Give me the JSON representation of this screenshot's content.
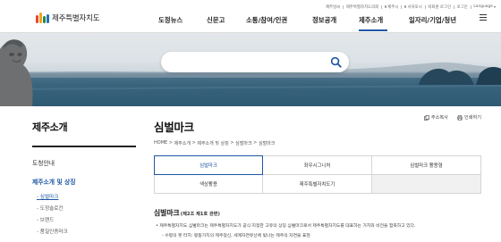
{
  "utility": {
    "items": [
      "제주날씨",
      "제주특별자치도의회",
      "제주시",
      "서귀포시",
      "비회원 로그인",
      "로그인"
    ],
    "language": "Language"
  },
  "header": {
    "logo_text": "제주특별자치도",
    "nav": [
      "도정뉴스",
      "신문고",
      "소통/참여/인권",
      "정보공개",
      "제주소개",
      "일자리/기업/청년"
    ],
    "active_nav": "제주소개"
  },
  "lnb": {
    "title": "제주소개",
    "items": [
      "도청안내",
      "제주소개 및 상징"
    ],
    "active_item": "제주소개 및 상징",
    "subitems": [
      "심벌마크",
      "도정슬로건",
      "브랜드",
      "품질인증마크"
    ],
    "active_subitem": "심벌마크"
  },
  "content": {
    "title": "심벌마크",
    "tools": [
      "주소복사",
      "인쇄하기"
    ],
    "breadcrumb": [
      "HOME",
      "제주소개",
      "제주소개 및 상징",
      "심벌마크",
      "심벌마크"
    ],
    "tabs": [
      "심벌마크",
      "좌우시그니처",
      "심벌마크 활용형",
      "색상활용",
      "제주특별자치도기"
    ],
    "active_tab": "심벌마크",
    "section_title": "심벌마크",
    "section_note": "(제2조 제1호 관련)",
    "bullet_1": "제주특별자치도 심벌마크는 제주특별자치도가 공식 지정한 고유의 상징 심벌마크로서 제주특별자치도를 대표하는 가치와 비전을 함축하고 있다.",
    "bullet_2": "수평의 붓 터치: 평등가치의 제주정신, 세계자연유산에 빛나는 제주의 자연을 표현"
  },
  "colors": {
    "accent": "#1f57a4",
    "logo_mark": [
      "#e7472b",
      "#f3a21b",
      "#1f8a4c",
      "#2a6fb6"
    ]
  }
}
